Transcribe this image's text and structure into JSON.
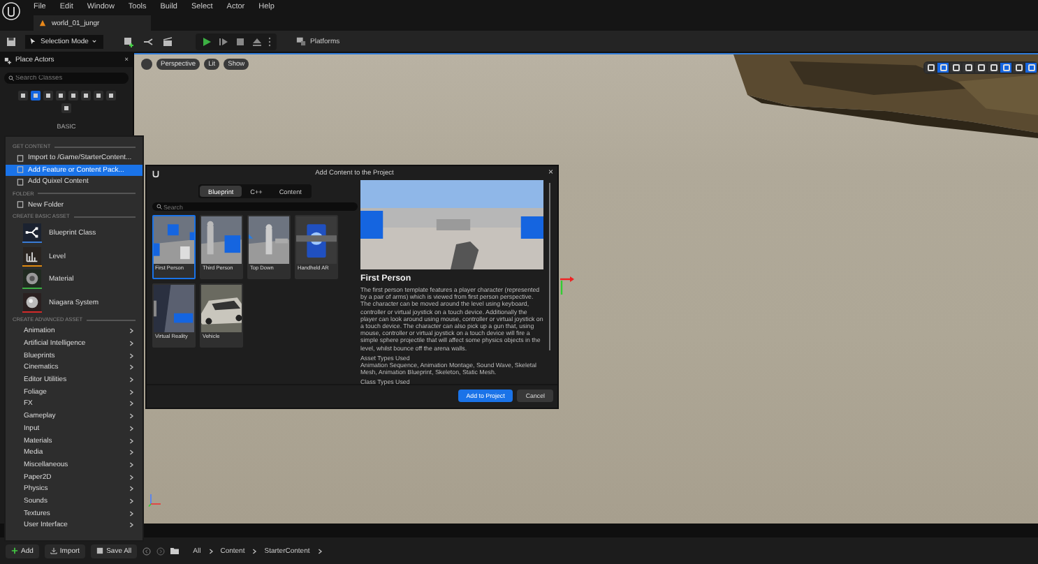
{
  "menu_bar": {
    "items": [
      "File",
      "Edit",
      "Window",
      "Tools",
      "Build",
      "Select",
      "Actor",
      "Help"
    ]
  },
  "document_tab": {
    "title": "world_01_jungr"
  },
  "toolbar": {
    "mode": "Selection Mode",
    "platforms": "Platforms"
  },
  "place_actors": {
    "title": "Place Actors",
    "close": "×",
    "search": {
      "placeholder": "Search Classes"
    },
    "category_tabs": [
      {
        "selected": false
      },
      {
        "selected": true
      },
      {
        "selected": false
      },
      {
        "selected": false
      },
      {
        "selected": false
      },
      {
        "selected": false
      },
      {
        "selected": false
      },
      {
        "selected": false
      },
      {
        "selected": false
      }
    ],
    "section": "BASIC"
  },
  "viewport": {
    "buttons": [
      "Perspective",
      "Lit",
      "Show"
    ],
    "tools": [
      {
        "selected": false
      },
      {
        "selected": true
      },
      {
        "selected": false
      },
      {
        "selected": false
      },
      {
        "selected": false
      },
      {
        "selected": false
      },
      {
        "selected": true
      },
      {
        "selected": false
      },
      {
        "selected": true
      }
    ]
  },
  "add_menu": {
    "sections": [
      {
        "heading": "GET CONTENT",
        "items": [
          {
            "kind": "action",
            "label": "Import to /Game/StarterContent...",
            "selected": false
          },
          {
            "kind": "action",
            "label": "Add Feature or Content Pack...",
            "selected": true
          },
          {
            "kind": "action",
            "label": "Add Quixel Content",
            "selected": false
          }
        ]
      },
      {
        "heading": "FOLDER",
        "items": [
          {
            "kind": "action",
            "label": "New Folder",
            "selected": false
          }
        ]
      },
      {
        "heading": "CREATE BASIC ASSET",
        "items": [
          {
            "kind": "asset",
            "label": "Blueprint Class",
            "color": "#3a7bd5",
            "selected": false
          },
          {
            "kind": "asset",
            "label": "Level",
            "color": "#e08a10",
            "selected": false
          },
          {
            "kind": "asset",
            "label": "Material",
            "color": "#3cb043",
            "selected": false
          },
          {
            "kind": "asset",
            "label": "Niagara System",
            "color": "#d22a2a",
            "selected": false
          }
        ]
      },
      {
        "heading": "CREATE ADVANCED ASSET",
        "items": [
          {
            "kind": "submenu",
            "label": "Animation",
            "selected": false
          },
          {
            "kind": "submenu",
            "label": "Artificial Intelligence",
            "selected": false
          },
          {
            "kind": "submenu",
            "label": "Blueprints",
            "selected": false
          },
          {
            "kind": "submenu",
            "label": "Cinematics",
            "selected": false
          },
          {
            "kind": "submenu",
            "label": "Editor Utilities",
            "selected": false
          },
          {
            "kind": "submenu",
            "label": "Foliage",
            "selected": false
          },
          {
            "kind": "submenu",
            "label": "FX",
            "selected": false
          },
          {
            "kind": "submenu",
            "label": "Gameplay",
            "selected": false
          },
          {
            "kind": "submenu",
            "label": "Input",
            "selected": false
          },
          {
            "kind": "submenu",
            "label": "Materials",
            "selected": false
          },
          {
            "kind": "submenu",
            "label": "Media",
            "selected": false
          },
          {
            "kind": "submenu",
            "label": "Miscellaneous",
            "selected": false
          },
          {
            "kind": "submenu",
            "label": "Paper2D",
            "selected": false
          },
          {
            "kind": "submenu",
            "label": "Physics",
            "selected": false
          },
          {
            "kind": "submenu",
            "label": "Sounds",
            "selected": false
          },
          {
            "kind": "submenu",
            "label": "Textures",
            "selected": false
          },
          {
            "kind": "submenu",
            "label": "User Interface",
            "selected": false
          }
        ]
      }
    ]
  },
  "dialog": {
    "title": "Add Content to the Project",
    "close": "×",
    "tabs": [
      {
        "label": "Blueprint",
        "selected": true
      },
      {
        "label": "C++",
        "selected": false
      },
      {
        "label": "Content",
        "selected": false
      }
    ],
    "search": {
      "placeholder": "Search"
    },
    "templates": [
      {
        "name": "First Person",
        "selected": true
      },
      {
        "name": "Third Person",
        "selected": false
      },
      {
        "name": "Top Down",
        "selected": false
      },
      {
        "name": "Handheld AR",
        "selected": false
      },
      {
        "name": "Virtual Reality",
        "selected": false
      },
      {
        "name": "Vehicle",
        "selected": false
      }
    ],
    "details": {
      "title": "First Person",
      "description": "The first person template features a player character (represented by a pair of arms) which is viewed from first person perspective. The character can be moved around the level using keyboard, controller or virtual joystick on a touch device. Additionally the player can look around using mouse, controller or virtual joystick on a touch device. The character can also pick up a gun that, using mouse, controller or virtual joystick on a touch device will fire a simple sphere projectile that will affect some physics objects in the level, whilst bounce off the arena walls.",
      "sections": [
        {
          "heading": "Asset Types Used",
          "text": "Animation Sequence, Animation Montage, Sound Wave, Skeletal Mesh, Animation Blueprint, Skeleton, Static Mesh."
        },
        {
          "heading": "Class Types Used"
        }
      ]
    },
    "buttons": [
      {
        "kind": "primary",
        "label": "Add to Project"
      },
      {
        "kind": "secondary",
        "label": "Cancel"
      }
    ]
  },
  "content_bar": {
    "buttons": [
      "Add",
      "Import",
      "Save All"
    ],
    "breadcrumb": [
      "All",
      "Content",
      "StarterContent"
    ]
  }
}
